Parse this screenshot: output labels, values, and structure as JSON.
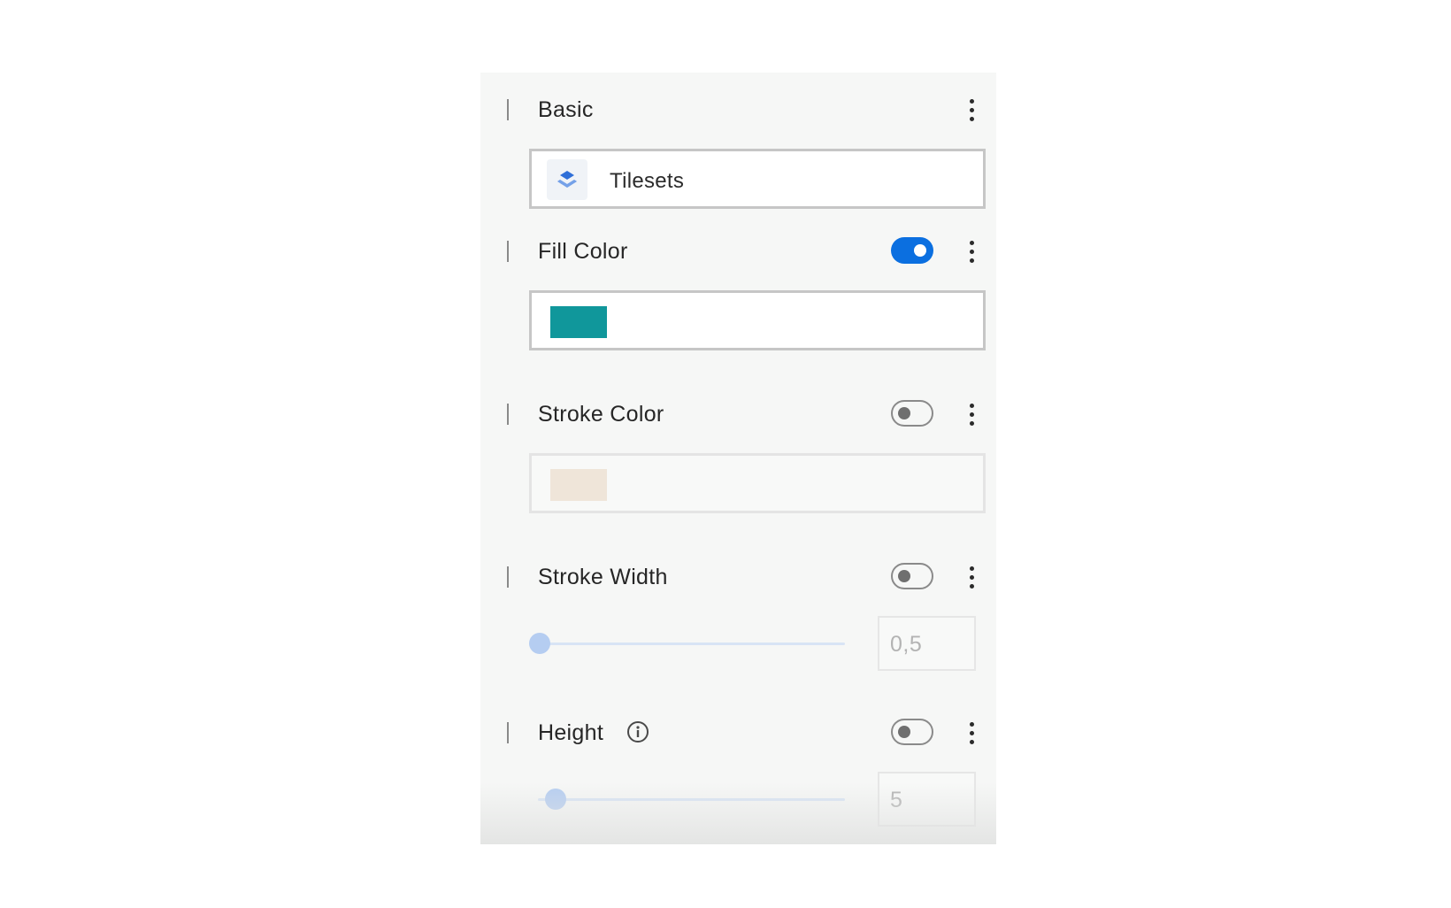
{
  "panel": {
    "sections": {
      "basic": {
        "title": "Basic",
        "source_label": "Tilesets",
        "source_icon": "layers-icon"
      },
      "fill_color": {
        "title": "Fill Color",
        "enabled": true,
        "color": "#10979b"
      },
      "stroke_color": {
        "title": "Stroke Color",
        "enabled": false,
        "color": "#efe5d9"
      },
      "stroke_width": {
        "title": "Stroke Width",
        "enabled": false,
        "value": "0,5",
        "slider_fraction": 0.0
      },
      "height": {
        "title": "Height",
        "enabled": false,
        "value": "5",
        "slider_fraction": 0.05
      }
    },
    "colors": {
      "toggle_on": "#0b6fe0",
      "slider_thumb": "#b5cdf1",
      "panel_bg": "#f6f7f6"
    }
  }
}
